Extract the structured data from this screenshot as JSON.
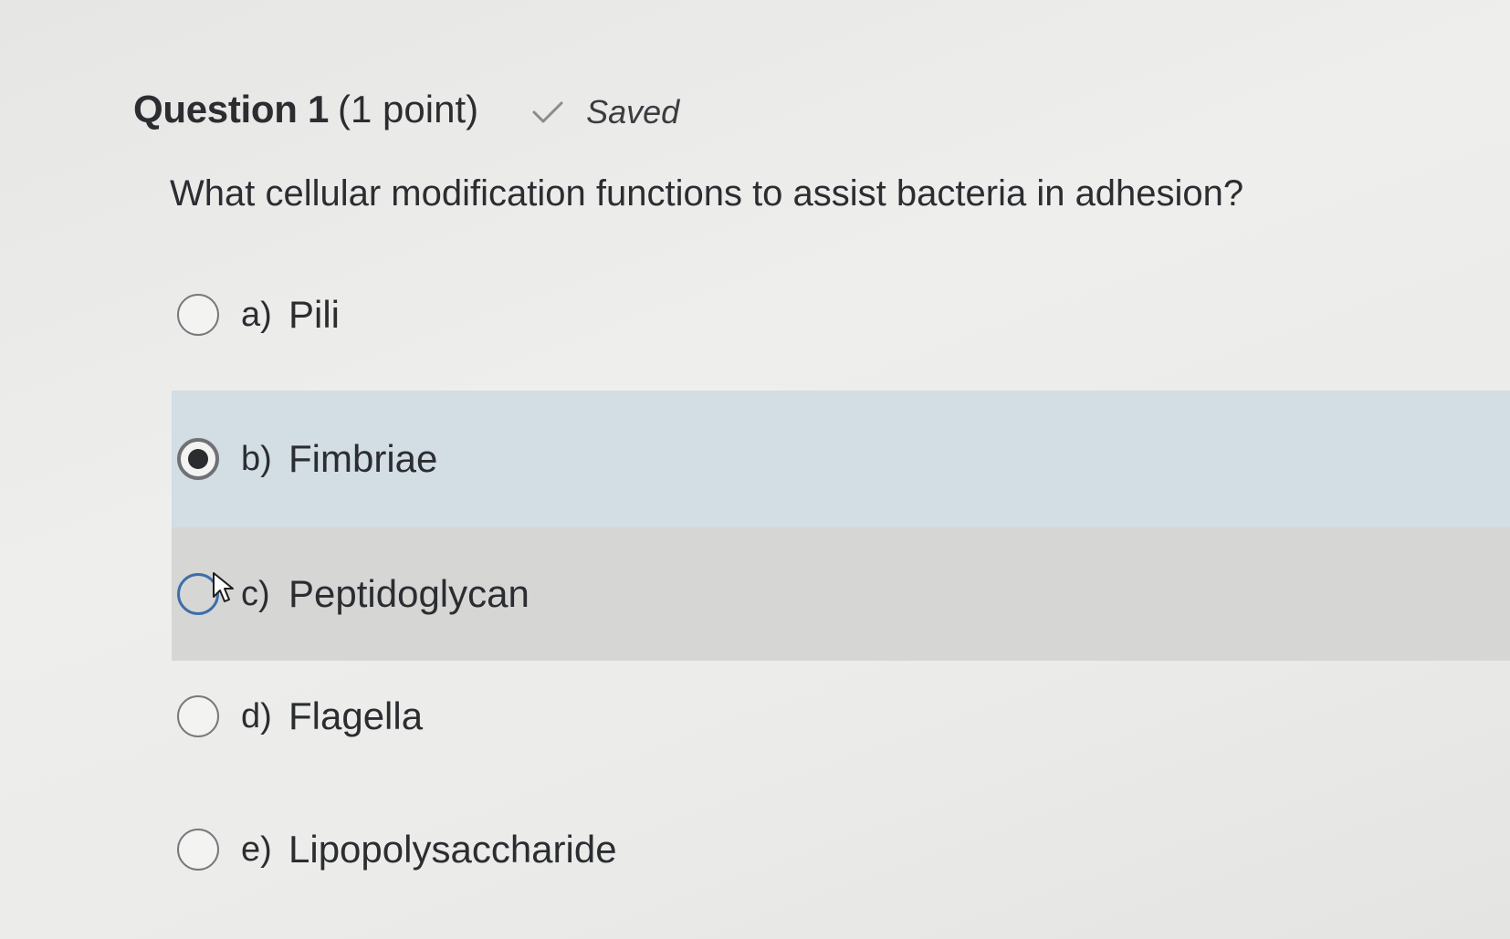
{
  "question": {
    "title": "Question 1",
    "points": "(1 point)",
    "status": "Saved",
    "status_icon": "check-icon",
    "text": "What cellular modification functions to assist bacteria in adhesion?"
  },
  "options": [
    {
      "letter": "a)",
      "text": "Pili",
      "selected": false
    },
    {
      "letter": "b)",
      "text": "Fimbriae",
      "selected": true
    },
    {
      "letter": "c)",
      "text": "Peptidoglycan",
      "selected": false
    },
    {
      "letter": "d)",
      "text": "Flagella",
      "selected": false
    },
    {
      "letter": "e)",
      "text": "Lipopolysaccharide",
      "selected": false
    }
  ],
  "colors": {
    "selected_row": "#d2dde4",
    "hover_row": "#d6d6d5",
    "focus_ring": "#3c6fa8"
  }
}
